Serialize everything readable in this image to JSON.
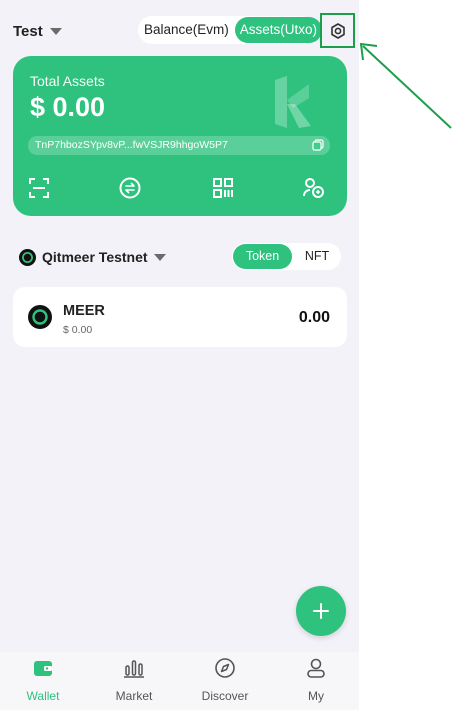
{
  "header": {
    "wallet_name": "Test",
    "mode_options": [
      "Balance(Evm)",
      "Assets(Utxo)"
    ],
    "active_mode": "Assets(Utxo)"
  },
  "card": {
    "label": "Total Assets",
    "amount": "$ 0.00",
    "address": "TnP7hbozSYpv8vP...fwVSJR9hhgoW5P7",
    "actions": [
      "scan-icon",
      "swap-icon",
      "qr-icon",
      "accounts-icon"
    ]
  },
  "network": {
    "name": "Qitmeer Testnet"
  },
  "asset_tabs": {
    "token_label": "Token",
    "nft_label": "NFT",
    "active": "Token"
  },
  "tokens": [
    {
      "symbol": "MEER",
      "fiat": "$ 0.00",
      "balance": "0.00"
    }
  ],
  "nav": [
    {
      "label": "Wallet",
      "icon": "wallet-icon",
      "active": true
    },
    {
      "label": "Market",
      "icon": "market-icon",
      "active": false
    },
    {
      "label": "Discover",
      "icon": "compass-icon",
      "active": false
    },
    {
      "label": "My",
      "icon": "user-icon",
      "active": false
    }
  ],
  "colors": {
    "accent": "#2ec27e",
    "background": "#f3f2f8",
    "annotation": "#1d9e4a"
  }
}
